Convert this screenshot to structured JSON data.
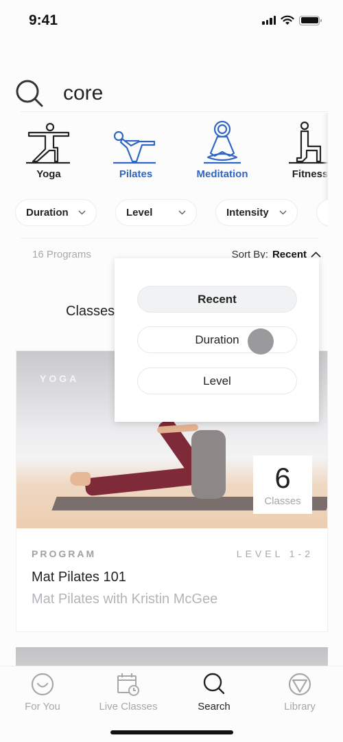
{
  "status_bar": {
    "time": "9:41"
  },
  "search": {
    "query": "core",
    "icon": "search-icon"
  },
  "categories": [
    {
      "label": "Yoga",
      "icon": "yoga-pose-icon",
      "active": false
    },
    {
      "label": "Pilates",
      "icon": "pilates-pose-icon",
      "active": true
    },
    {
      "label": "Meditation",
      "icon": "meditation-pose-icon",
      "active": true
    },
    {
      "label": "Fitness",
      "icon": "fitness-pose-icon",
      "active": false
    }
  ],
  "filters": [
    {
      "label": "Duration"
    },
    {
      "label": "Level"
    },
    {
      "label": "Intensity"
    }
  ],
  "results": {
    "count_label": "16 Programs",
    "sort_label": "Sort By:",
    "sort_value": "Recent"
  },
  "section_tab": "Classes",
  "sort_dropdown": {
    "options": [
      {
        "label": "Recent",
        "selected": true
      },
      {
        "label": "Duration",
        "selected": false
      },
      {
        "label": "Level",
        "selected": false
      }
    ]
  },
  "card": {
    "badge": "YOGA",
    "classes_count": "6",
    "classes_label": "Classes",
    "type": "PROGRAM",
    "level": "LEVEL 1-2",
    "title": "Mat Pilates 101",
    "subtitle": "Mat Pilates with Kristin McGee"
  },
  "tab_bar": {
    "tabs": [
      {
        "label": "For You",
        "icon": "smile-icon",
        "active": false
      },
      {
        "label": "Live Classes",
        "icon": "calendar-clock-icon",
        "active": false
      },
      {
        "label": "Search",
        "icon": "search-icon",
        "active": true
      },
      {
        "label": "Library",
        "icon": "triangle-circle-icon",
        "active": false
      }
    ]
  },
  "colors": {
    "accent": "#2f66c4",
    "text": "#222222",
    "muted": "#a8a6a9"
  }
}
